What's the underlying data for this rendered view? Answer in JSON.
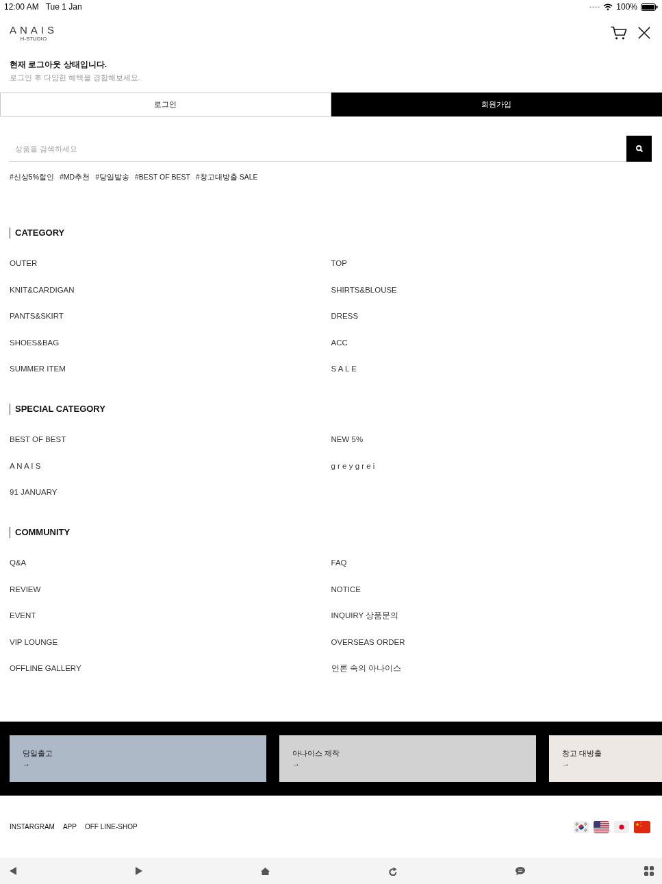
{
  "status_bar": {
    "time": "12:00 AM",
    "date": "Tue 1 Jan",
    "battery": "100%"
  },
  "header": {
    "logo": "ANAIS",
    "logo_subtitle": "H-STUDIO"
  },
  "login_notice": {
    "title": "현재 로그아웃 상태입니다.",
    "subtitle": "로그인 후 다양한 혜택을 경험해보세요."
  },
  "auth_buttons": [
    {
      "label": "로그인",
      "kind": "outline"
    },
    {
      "label": "회원가입",
      "kind": "filled"
    }
  ],
  "search": {
    "placeholder": "상품을 검색하세요"
  },
  "hashtags": [
    "#신상5%할인",
    "#MD추천",
    "#당일발송",
    "#BEST OF BEST",
    "#창고대방출 SALE"
  ],
  "sections": [
    {
      "title": "CATEGORY",
      "items": [
        "OUTER",
        "TOP",
        "KNIT&CARDIGAN",
        "SHIRTS&BLOUSE",
        "PANTS&SKIRT",
        "DRESS",
        "SHOES&BAG",
        "ACC",
        "SUMMER ITEM",
        "S A L E"
      ]
    },
    {
      "title": "SPECIAL CATEGORY",
      "items": [
        "BEST OF BEST",
        "NEW 5%",
        "A N A I S",
        "g r e y g r e i",
        "91 JANUARY"
      ]
    },
    {
      "title": "COMMUNITY",
      "items": [
        "Q&A",
        "FAQ",
        "REVIEW",
        "NOTICE",
        "EVENT",
        "INQUIRY 상품문의",
        "VIP LOUNGE",
        "OVERSEAS ORDER",
        "OFFLINE GALLERY",
        "언론 속의 아나이스"
      ]
    }
  ],
  "banners": [
    {
      "title": "당일출고",
      "arrow": "→",
      "color": "#adb9c7"
    },
    {
      "title": "아나이스 제작",
      "arrow": "→",
      "color": "#d3d2d3"
    },
    {
      "title": "창고 대방출",
      "arrow": "→",
      "color": "#ede8e4"
    }
  ],
  "footer_links": [
    "INSTARGRAM",
    "APP",
    "OFF LINE-SHOP"
  ]
}
